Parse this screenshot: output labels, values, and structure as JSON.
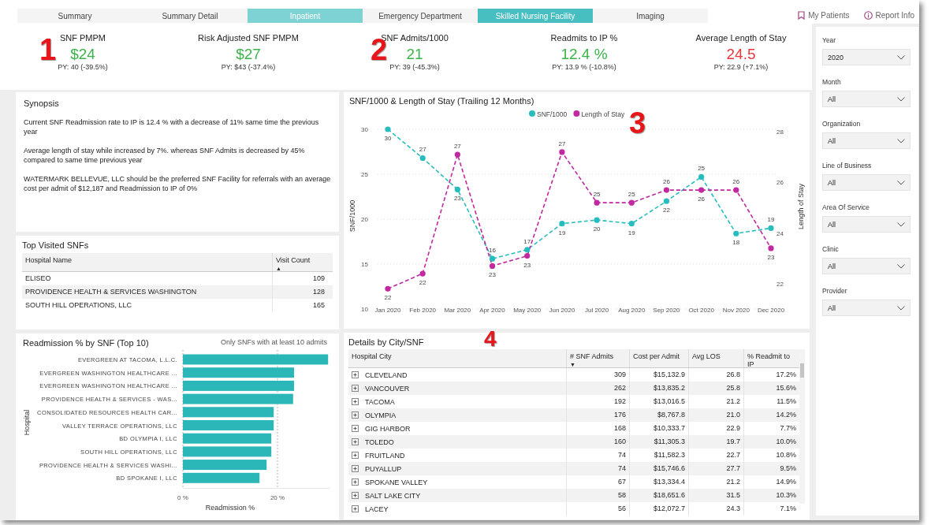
{
  "tabs": [
    {
      "label": "Summary",
      "selected": false,
      "highlighted": false
    },
    {
      "label": "Summary Detail",
      "selected": false,
      "highlighted": false
    },
    {
      "label": "Inpatient",
      "selected": false,
      "highlighted": true
    },
    {
      "label": "Emergency Department",
      "selected": false,
      "highlighted": false
    },
    {
      "label": "Skilled Nursing Facility",
      "selected": true,
      "highlighted": false
    },
    {
      "label": "Imaging",
      "selected": false,
      "highlighted": false
    }
  ],
  "header_links": [
    {
      "label": "My Patients"
    },
    {
      "label": "Report Info"
    }
  ],
  "kpis": [
    {
      "title": "SNF PMPM",
      "value": "$24",
      "color": "#3cb44b",
      "prior": "PY: 40 (-39.5%)",
      "marker": "1"
    },
    {
      "title": "Risk Adjusted SNF PMPM",
      "value": "$27",
      "color": "#3cb44b",
      "prior": "PY: $43 (-37.4%)"
    },
    {
      "title": "SNF Admits/1000",
      "value": "21",
      "color": "#3cb44b",
      "prior": "PY: 39 (-45.3%)",
      "marker": "2"
    },
    {
      "title": "Readmits to IP %",
      "value": "12.4 %",
      "color": "#3cb44b",
      "prior": "PY: 13.9 % (-10.8%)"
    },
    {
      "title": "Average Length of Stay",
      "value": "24.5",
      "color": "#e8383d",
      "prior": "PY: 22.9 (+7.1%)"
    }
  ],
  "synopsis": {
    "title": "Synopsis",
    "paragraphs": [
      "Current SNF Readmission rate to IP is 12.4 % with a decrease of 11% same time the previous year",
      "Average length of stay while increased by 7%. whereas SNF Admits is decreased by 45% compared to same time previous year",
      "WATERMARK BELLEVUE, LLC should be the preferred SNF Facility for referrals with an average cost per admit of $12,187 and Readmission to IP of 0%"
    ]
  },
  "top_visited": {
    "title": "Top Visited SNFs",
    "columns": [
      {
        "label": "Hospital Name"
      },
      {
        "label": "Visit Count",
        "sort": "▲"
      }
    ],
    "rows": [
      [
        "ELISEO",
        "109"
      ],
      [
        "PROVIDENCE HEALTH & SERVICES WASHINGTON",
        "128"
      ],
      [
        "SOUTH HILL OPERATIONS, LLC",
        "165"
      ]
    ]
  },
  "readmission_chart": {
    "title": "Readmission % by SNF (Top 10)",
    "note": "Only SNFs with at least 10 admits",
    "chart_data": {
      "type": "bar",
      "orientation": "horizontal",
      "xlabel": "Readmission %",
      "ylabel": "Hospital",
      "categories": [
        "EVERGREEN AT TACOMA, L.L.C.",
        "EVERGREEN WASHINGTON HEALTHCARE ...",
        "EVERGREEN WASHINGTON HEALTHCARE ...",
        "PROVIDENCE HEALTH & SERVICES - WAS...",
        "CONSOLIDATED RESOURCES HEALTH CAR...",
        "VALLEY TERRACE OPERATIONS, LLC",
        "BD OLYMPIA I, LLC",
        "SOUTH HILL OPERATIONS, LLC",
        "PROVIDENCE HEALTH & SERVICES WASHI...",
        "BD SPOKANE I, LLC"
      ],
      "series": [
        {
          "color": "#2bb6b8",
          "values": [
            30.7,
            23.5,
            23.5,
            23.3,
            19.2,
            19.2,
            18.7,
            18.7,
            17.7,
            16.2
          ]
        }
      ],
      "xlim": [
        0,
        31
      ],
      "xticks": [
        {
          "value": 0,
          "label": "0 %"
        },
        {
          "value": 20,
          "label": "20 %"
        }
      ],
      "grid": true
    }
  },
  "trend_chart": {
    "title": "SNF/1000 & Length of Stay (Trailing 12 Months)",
    "marker": "3",
    "chart_data": {
      "type": "line",
      "ylabel": "SNF/1000",
      "y2label": "Length of Stay",
      "x": [
        "Jan 2020",
        "Feb 2020",
        "Mar 2020",
        "Apr 2020",
        "May 2020",
        "Jun 2020",
        "Jul 2020",
        "Aug 2020",
        "Sep 2020",
        "Oct 2020",
        "Nov 2020",
        "Dec 2020"
      ],
      "series": [
        {
          "name": "SNF/1000",
          "color": "#27bdbf",
          "axis": "y",
          "line_style": "dashed",
          "marker": "circle",
          "values": [
            30,
            26.8,
            23.3,
            15.6,
            16.6,
            19.5,
            19.9,
            19.5,
            22.0,
            24.7,
            18.4,
            19.0
          ],
          "value_labels": [
            "30",
            "27",
            "23",
            "16",
            "17",
            "19",
            "20",
            "19",
            "22",
            "25",
            "18",
            "19"
          ]
        },
        {
          "name": "Length of Stay",
          "color": "#c2289f",
          "axis": "y2",
          "line_style": "dashed",
          "marker": "circle",
          "values": [
            21.8,
            22.4,
            27.1,
            22.7,
            23.1,
            27.2,
            25.2,
            25.2,
            25.7,
            25.7,
            25.7,
            23.4
          ],
          "value_labels": [
            "22",
            "22",
            "27",
            "23",
            "23",
            "27",
            "25",
            "25",
            "26",
            "26",
            "26",
            "23"
          ]
        }
      ],
      "ylim": [
        10,
        30
      ],
      "yticks": [
        10,
        15,
        20,
        25,
        30
      ],
      "y2lim": [
        21,
        28.1
      ],
      "y2ticks": [
        22,
        24,
        26,
        28
      ],
      "grid": true,
      "legend": "top"
    }
  },
  "details": {
    "title": "Details by City/SNF",
    "marker": "4",
    "columns": [
      {
        "label": "Hospital City"
      },
      {
        "label": "# SNF Admits",
        "sort": "▼"
      },
      {
        "label": "Cost per Admit"
      },
      {
        "label": "Avg LOS"
      },
      {
        "label": "% Readmit to IP"
      }
    ],
    "rows": [
      {
        "expanded": false,
        "cells": [
          "CLEVELAND",
          "309",
          "$15,132.9",
          "26.8",
          "17.2%"
        ]
      },
      {
        "expanded": false,
        "cells": [
          "VANCOUVER",
          "262",
          "$13,835.2",
          "25.8",
          "15.6%"
        ]
      },
      {
        "expanded": false,
        "cells": [
          "TACOMA",
          "192",
          "$13,016.5",
          "21.2",
          "11.5%"
        ]
      },
      {
        "expanded": false,
        "cells": [
          "OLYMPIA",
          "176",
          "$8,767.8",
          "21.0",
          "14.2%"
        ]
      },
      {
        "expanded": false,
        "cells": [
          "GIG HARBOR",
          "168",
          "$10,333.7",
          "22.9",
          "7.7%"
        ]
      },
      {
        "expanded": false,
        "cells": [
          "TOLEDO",
          "160",
          "$11,305.3",
          "19.7",
          "10.0%"
        ]
      },
      {
        "expanded": false,
        "cells": [
          "FRUITLAND",
          "74",
          "$11,582.3",
          "22.7",
          "10.8%"
        ]
      },
      {
        "expanded": false,
        "cells": [
          "PUYALLUP",
          "74",
          "$15,746.6",
          "27.7",
          "9.5%"
        ]
      },
      {
        "expanded": false,
        "cells": [
          "SPOKANE VALLEY",
          "67",
          "$13,334.4",
          "21.2",
          "14.9%"
        ]
      },
      {
        "expanded": false,
        "cells": [
          "SALT LAKE CITY",
          "58",
          "$18,651.6",
          "31.5",
          "10.3%"
        ]
      },
      {
        "expanded": false,
        "cells": [
          "LACEY",
          "56",
          "$12,072.7",
          "24.3",
          "7.1%"
        ]
      }
    ]
  },
  "filters": [
    {
      "label": "Year",
      "value": "2020"
    },
    {
      "label": "Month",
      "value": "All"
    },
    {
      "label": "Organization",
      "value": "All"
    },
    {
      "label": "Line of Business",
      "value": "All"
    },
    {
      "label": "Area Of Service",
      "value": "All"
    },
    {
      "label": "Clinic",
      "value": "All"
    },
    {
      "label": "Provider",
      "value": "All"
    }
  ]
}
